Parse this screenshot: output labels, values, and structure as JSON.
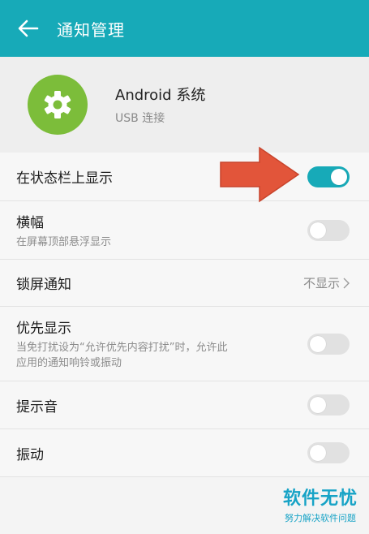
{
  "header": {
    "back_icon": "arrow-left-icon",
    "title": "通知管理",
    "bg_color": "#17aab8"
  },
  "app": {
    "icon": "gear-icon",
    "icon_color": "#7cbd3a",
    "name": "Android 系统",
    "subtitle": "USB 连接"
  },
  "settings": {
    "status_bar": {
      "title": "在状态栏上显示",
      "enabled": true
    },
    "banner": {
      "title": "横幅",
      "subtitle": "在屏幕顶部悬浮显示",
      "enabled": false
    },
    "lock_screen": {
      "title": "锁屏通知",
      "value": "不显示"
    },
    "priority": {
      "title": "优先显示",
      "subtitle_line1": "当免打扰设为“允许优先内容打扰”时，允许此",
      "subtitle_line2": "应用的通知响铃或振动",
      "enabled": false
    },
    "sound": {
      "title": "提示音",
      "enabled": false
    },
    "vibrate": {
      "title": "振动",
      "enabled": false
    }
  },
  "watermark": {
    "main": "软件无忧",
    "sub": "努力解决软件问题",
    "color": "#17a3c6"
  },
  "annotation": {
    "arrow_color": "#e2553a"
  }
}
